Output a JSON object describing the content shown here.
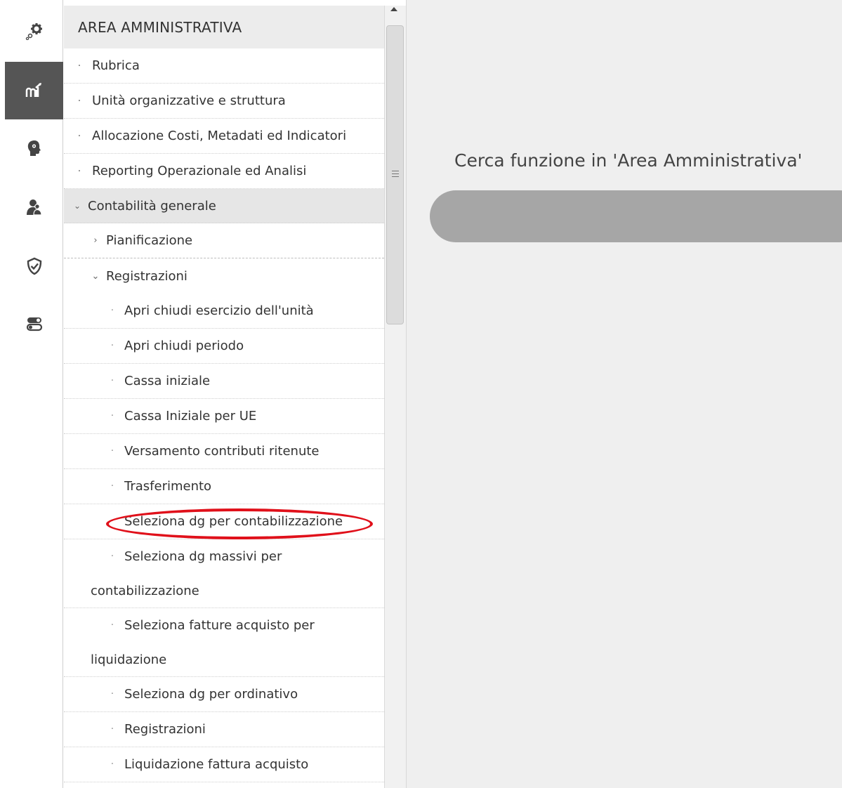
{
  "rail": {
    "items": [
      {
        "icon": "gears-icon",
        "active": false
      },
      {
        "icon": "chart-icon",
        "active": true
      },
      {
        "icon": "brain-icon",
        "active": false
      },
      {
        "icon": "users-icon",
        "active": false
      },
      {
        "icon": "shield-check-icon",
        "active": false
      },
      {
        "icon": "toggles-icon",
        "active": false
      }
    ],
    "active_color": "#555555"
  },
  "menu": {
    "title": "AREA AMMINISTRATIVA",
    "items": [
      {
        "label": "Rubrica",
        "marker": "·"
      },
      {
        "label": "Unità organizzative e struttura",
        "marker": "·"
      },
      {
        "label": "Allocazione Costi, Metadati ed Indicatori",
        "marker": "·"
      },
      {
        "label": "Reporting Operazionale ed Analisi",
        "marker": "·"
      }
    ],
    "group": {
      "label": "Contabilità generale",
      "marker": "⌄"
    },
    "sub": [
      {
        "label": "Pianificazione",
        "marker": "›"
      },
      {
        "label": "Registrazioni",
        "marker": "⌄"
      }
    ],
    "leaves": [
      {
        "label": "Apri chiudi esercizio dell'unità"
      },
      {
        "label": "Apri chiudi periodo"
      },
      {
        "label": "Cassa iniziale"
      },
      {
        "label": "Cassa Iniziale per UE"
      },
      {
        "label": "Versamento contributi ritenute"
      },
      {
        "label": "Trasferimento"
      },
      {
        "label": "Seleziona dg per contabilizzazione"
      },
      {
        "line1": "Seleziona dg massivi per",
        "line2": "contabilizzazione"
      },
      {
        "line1": "Seleziona fatture acquisto per",
        "line2": "liquidazione"
      },
      {
        "label": "Seleziona dg per ordinativo"
      },
      {
        "label": "Registrazioni"
      },
      {
        "label": "Liquidazione fattura acquisto"
      }
    ],
    "leaf_marker": "·",
    "highlight_color": "#e0101a"
  },
  "main": {
    "search_label": "Cerca funzione in 'Area Amministrativa'",
    "search_value": ""
  }
}
